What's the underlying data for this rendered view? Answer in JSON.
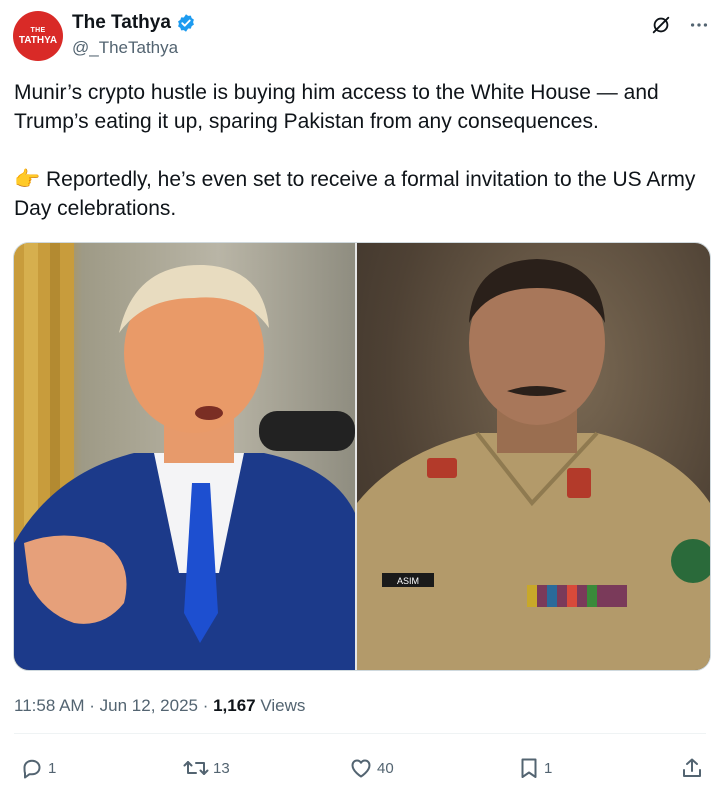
{
  "author": {
    "name": "The Tathya",
    "handle": "@_TheTathya",
    "avatar_text_top": "THE",
    "avatar_text_bottom": "TATHYA",
    "verified": true
  },
  "post": {
    "paragraph1": "Munir’s crypto hustle is buying him access to the White House — and Trump’s eating it up, sparing Pakistan from any consequences.",
    "paragraph2": "👉 Reportedly, he’s even set to receive a formal invitation to the US Army Day celebrations."
  },
  "media": {
    "left_badge_name": "ASIM"
  },
  "meta": {
    "time_date": "11:58 AM · Jun 12, 2025 · ",
    "views_count": "1,167",
    "views_label": " Views"
  },
  "actions": {
    "replies": "1",
    "reposts": "13",
    "likes": "40",
    "bookmarks": "1"
  },
  "colors": {
    "avatar_bg": "#d92a27",
    "verified": "#1d9bf0",
    "secondary_text": "#536471"
  },
  "icons": [
    "verified-badge-icon",
    "grok-icon",
    "more-icon",
    "reply-icon",
    "repost-icon",
    "like-icon",
    "bookmark-icon",
    "share-icon"
  ]
}
